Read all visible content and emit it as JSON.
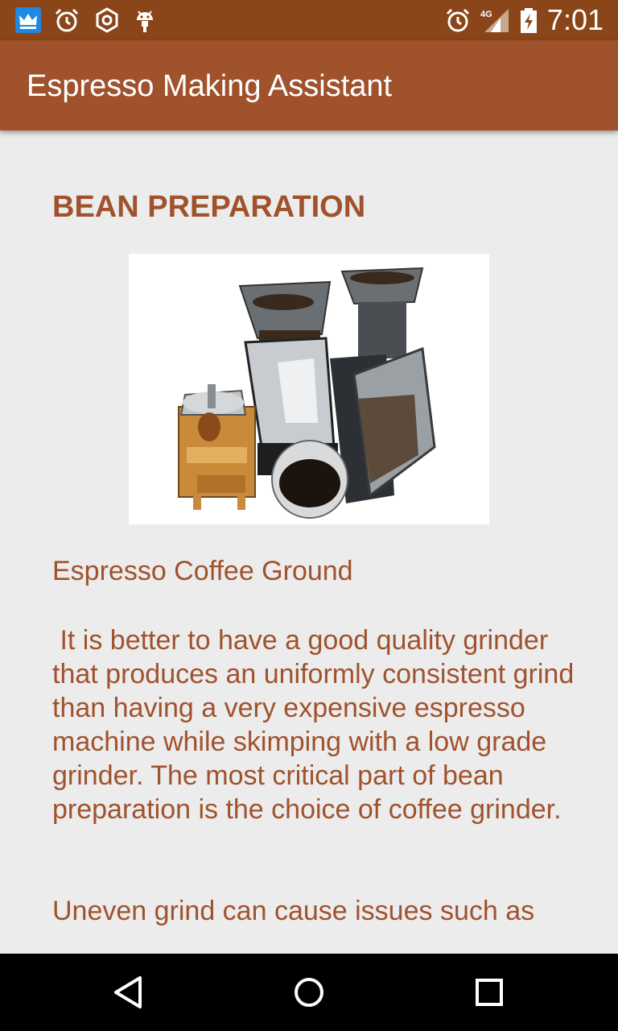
{
  "status_bar": {
    "time": "7:01",
    "network": "4G",
    "icons": [
      "crown-app-icon",
      "alarm-icon",
      "settings-hex-icon",
      "android-icon",
      "alarm-icon",
      "signal-icon",
      "battery-charging-icon"
    ]
  },
  "app_bar": {
    "title": "Espresso Making Assistant"
  },
  "main": {
    "section_title": "BEAN PREPARATION",
    "image_caption": "Espresso Coffee Ground",
    "paragraph_1": " It is better to have a good quality grinder that produces an uniformly consistent grind than having a very expensive espresso machine while skimping with a low grade grinder. The most critical part of bean preparation is the choice of coffee grinder.",
    "paragraph_2": "Uneven grind can cause issues such as"
  },
  "nav_bar": {
    "buttons": [
      "back-icon",
      "home-icon",
      "recents-icon"
    ]
  },
  "colors": {
    "status_bar": "#8a4518",
    "app_bar": "#a0522d",
    "text_accent": "#a0522d",
    "background": "#ececec"
  }
}
